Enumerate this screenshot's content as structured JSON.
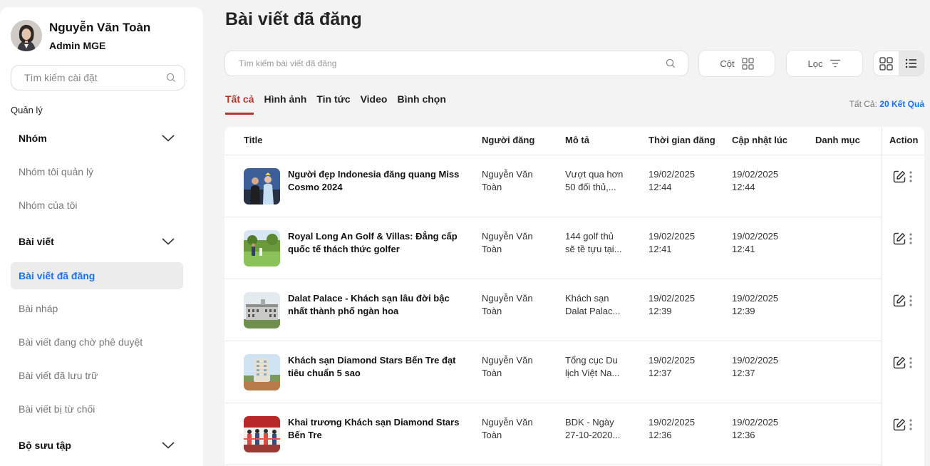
{
  "profile": {
    "name": "Nguyễn Văn Toàn",
    "role": "Admin MGE"
  },
  "sidebar": {
    "search_placeholder": "Tìm kiếm cài đặt",
    "section_label": "Quản lý",
    "groups": [
      {
        "label": "Nhóm",
        "items": [
          "Nhóm tôi quản lý",
          "Nhóm của tôi"
        ]
      },
      {
        "label": "Bài viết",
        "items": [
          "Bài viết đã đăng",
          "Bài nháp",
          "Bài viết đang chờ phê duyệt",
          "Bài viết đã lưu trữ",
          "Bài viết bị từ chối"
        ]
      },
      {
        "label": "Bộ sưu tập",
        "items": []
      }
    ],
    "active_item": "Bài viết đã đăng"
  },
  "main": {
    "title": "Bài viết đã đăng",
    "search_placeholder": "Tìm kiếm bài viết đã đăng",
    "columns_button": "Cột",
    "filter_button": "Lọc",
    "tabs": [
      "Tất cả",
      "Hình ảnh",
      "Tin tức",
      "Video",
      "Bình chọn"
    ],
    "active_tab": "Tất cả",
    "count_label": "Tất Cả:",
    "count_value": "20 Kết Quả"
  },
  "table": {
    "headers": {
      "title": "Title",
      "author": "Người đăng",
      "desc": "Mô tả",
      "posted": "Thời gian đăng",
      "updated": "Cập nhật lúc",
      "category": "Danh mục",
      "action": "Action"
    },
    "rows": [
      {
        "title": "Người đẹp Indonesia đăng quang Miss Cosmo 2024",
        "author": "Nguyễn Văn Toàn",
        "desc1": "Vượt qua hơn",
        "desc2": "50 đối thủ,...",
        "posted_date": "19/02/2025",
        "posted_time": "12:44",
        "updated_date": "19/02/2025",
        "updated_time": "12:44",
        "category": ""
      },
      {
        "title": "Royal Long An Golf & Villas: Đẳng cấp quốc tế thách thức golfer",
        "author": "Nguyễn Văn Toàn",
        "desc1": "144 golf thủ",
        "desc2": "sẽ tề tựu tại...",
        "posted_date": "19/02/2025",
        "posted_time": "12:41",
        "updated_date": "19/02/2025",
        "updated_time": "12:41",
        "category": ""
      },
      {
        "title": "Dalat Palace - Khách sạn lâu đời bậc nhất thành phố ngàn hoa",
        "author": "Nguyễn Văn Toàn",
        "desc1": "Khách sạn",
        "desc2": "Dalat Palac...",
        "posted_date": "19/02/2025",
        "posted_time": "12:39",
        "updated_date": "19/02/2025",
        "updated_time": "12:39",
        "category": ""
      },
      {
        "title": "Khách sạn Diamond Stars Bến Tre đạt tiêu chuẩn 5 sao",
        "author": "Nguyễn Văn Toàn",
        "desc1": "Tổng cục Du",
        "desc2": "lịch Việt Na...",
        "posted_date": "19/02/2025",
        "posted_time": "12:37",
        "updated_date": "19/02/2025",
        "updated_time": "12:37",
        "category": ""
      },
      {
        "title": "Khai trương Khách sạn Diamond Stars Bến Tre",
        "author": "Nguyễn Văn Toàn",
        "desc1": "BDK - Ngày",
        "desc2": "27-10-2020...",
        "posted_date": "19/02/2025",
        "posted_time": "12:36",
        "updated_date": "19/02/2025",
        "updated_time": "12:36",
        "category": ""
      }
    ]
  },
  "colors": {
    "accent_blue": "#1a73e8",
    "active_tab_red": "#b3362b"
  },
  "icons": [
    "search-icon",
    "chevron-down-icon",
    "columns-grid-icon",
    "filter-icon",
    "grid-view-icon",
    "list-view-icon",
    "edit-icon",
    "more-vertical-icon"
  ]
}
